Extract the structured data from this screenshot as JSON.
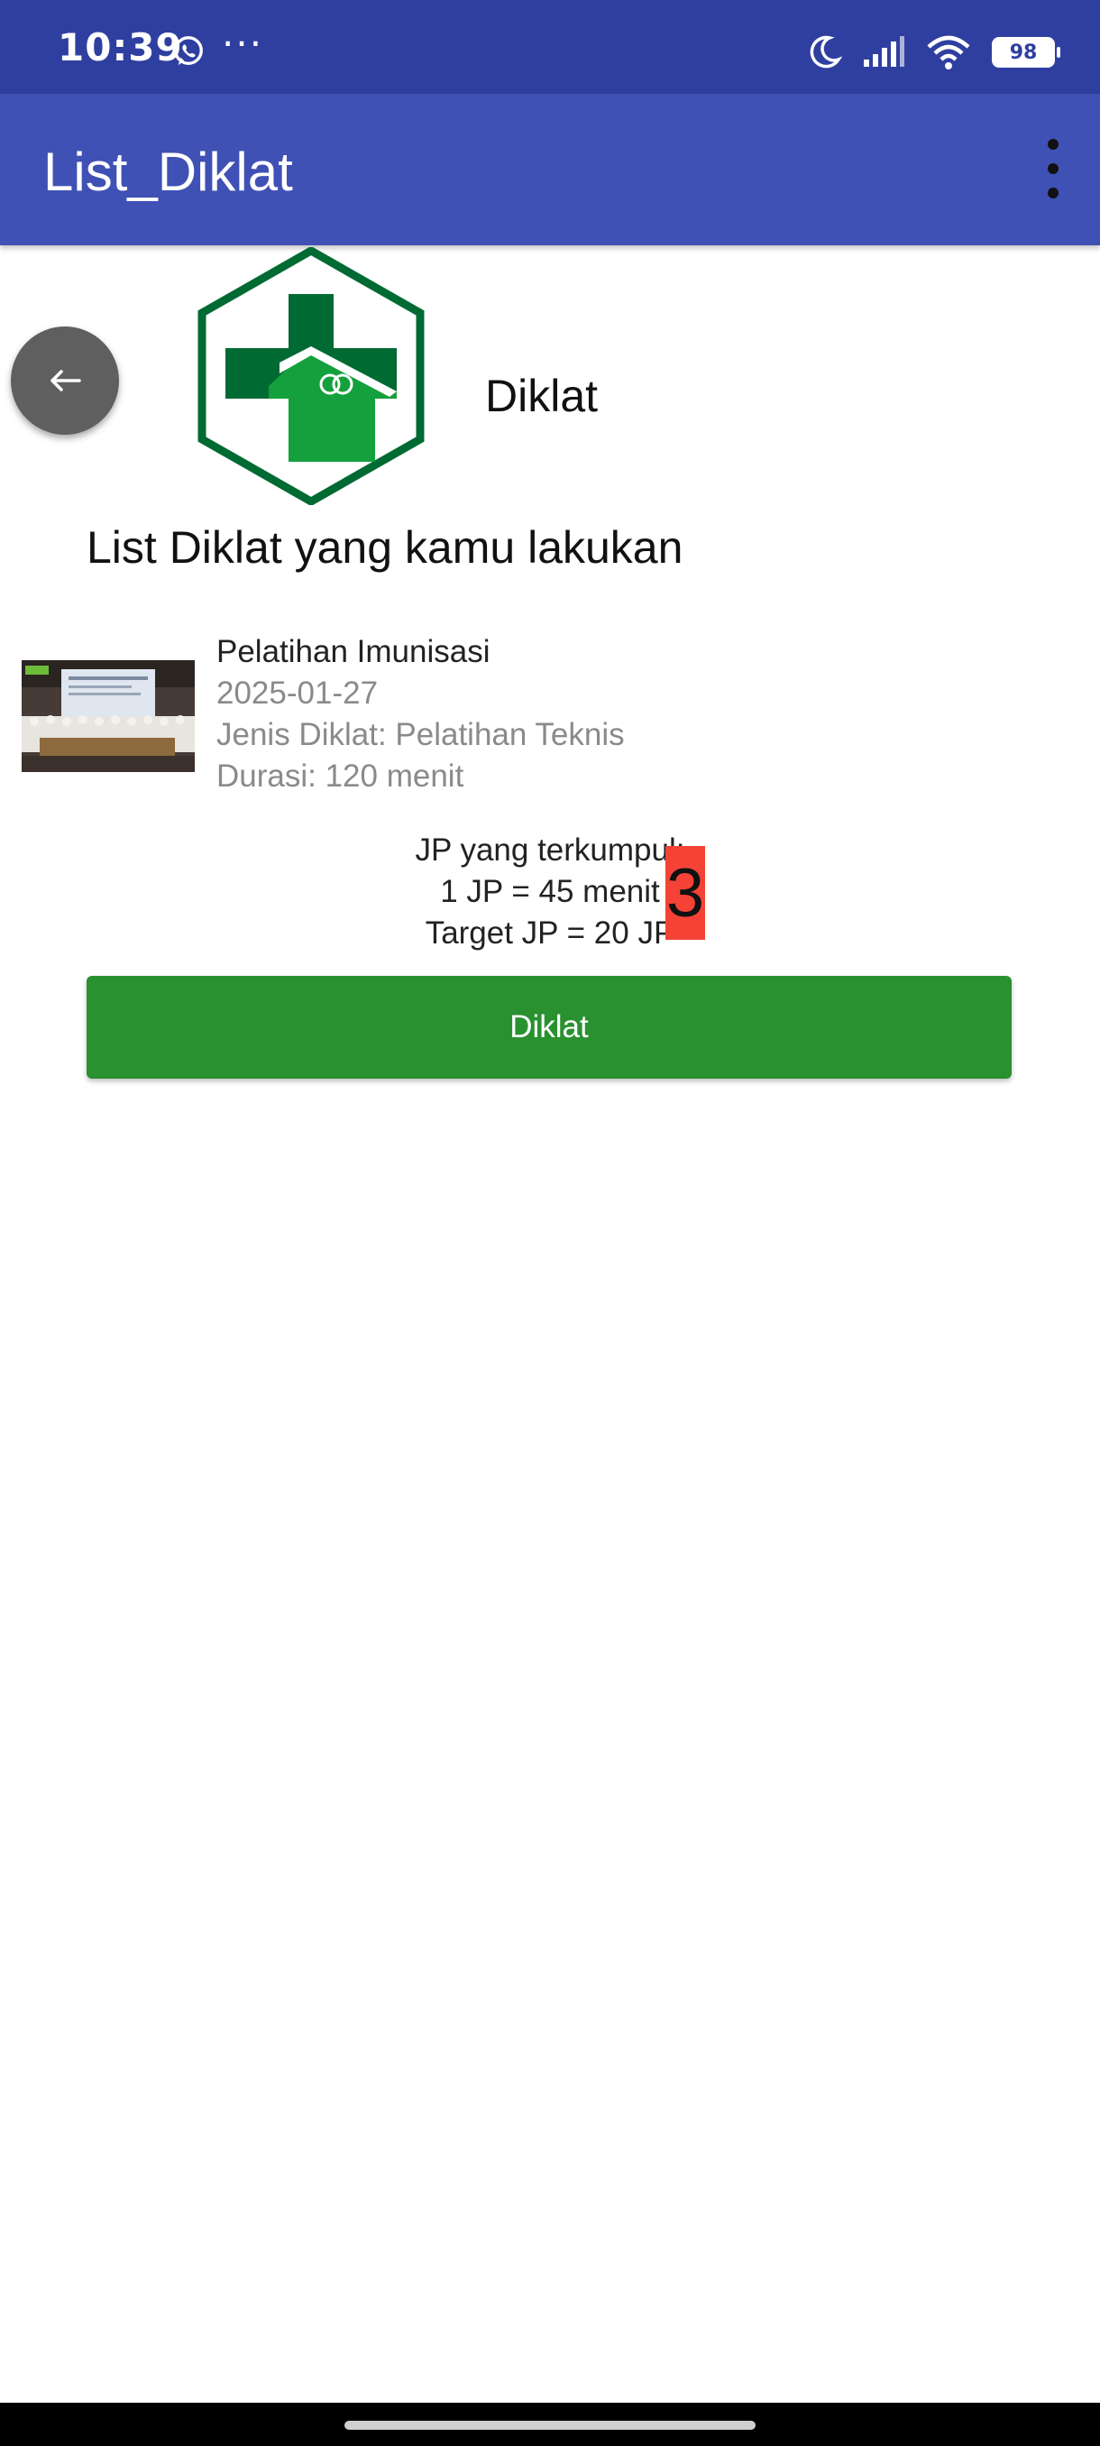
{
  "status_bar": {
    "time": "10:39",
    "more": "···",
    "battery": "98",
    "icons": [
      "whatsapp-icon",
      "moon-icon",
      "signal-icon",
      "wifi-icon",
      "battery-icon"
    ]
  },
  "app_bar": {
    "title": "List_Diklat",
    "menu_icon": "overflow-menu-icon"
  },
  "header": {
    "title": "Diklat",
    "logo": "kemenkes-logo"
  },
  "section_title": "List Diklat yang kamu lakukan",
  "diklat_items": [
    {
      "name": "Pelatihan Imunisasi",
      "date": "2025-01-27",
      "jenis": "Jenis Diklat: Pelatihan Teknis",
      "durasi": "Durasi: 120 menit"
    }
  ],
  "jp_summary": {
    "collected_label": "JP yang terkumpul:",
    "conversion": "1 JP = 45 menit",
    "target": "Target JP = 20 JP",
    "collected_value": "3"
  },
  "actions": {
    "diklat_button": "Diklat"
  },
  "colors": {
    "status_bar": "#2f3fa0",
    "app_bar": "#3f51b5",
    "button_green": "#2a9130",
    "badge_red": "#f44336",
    "logo_green": "#006a33"
  }
}
